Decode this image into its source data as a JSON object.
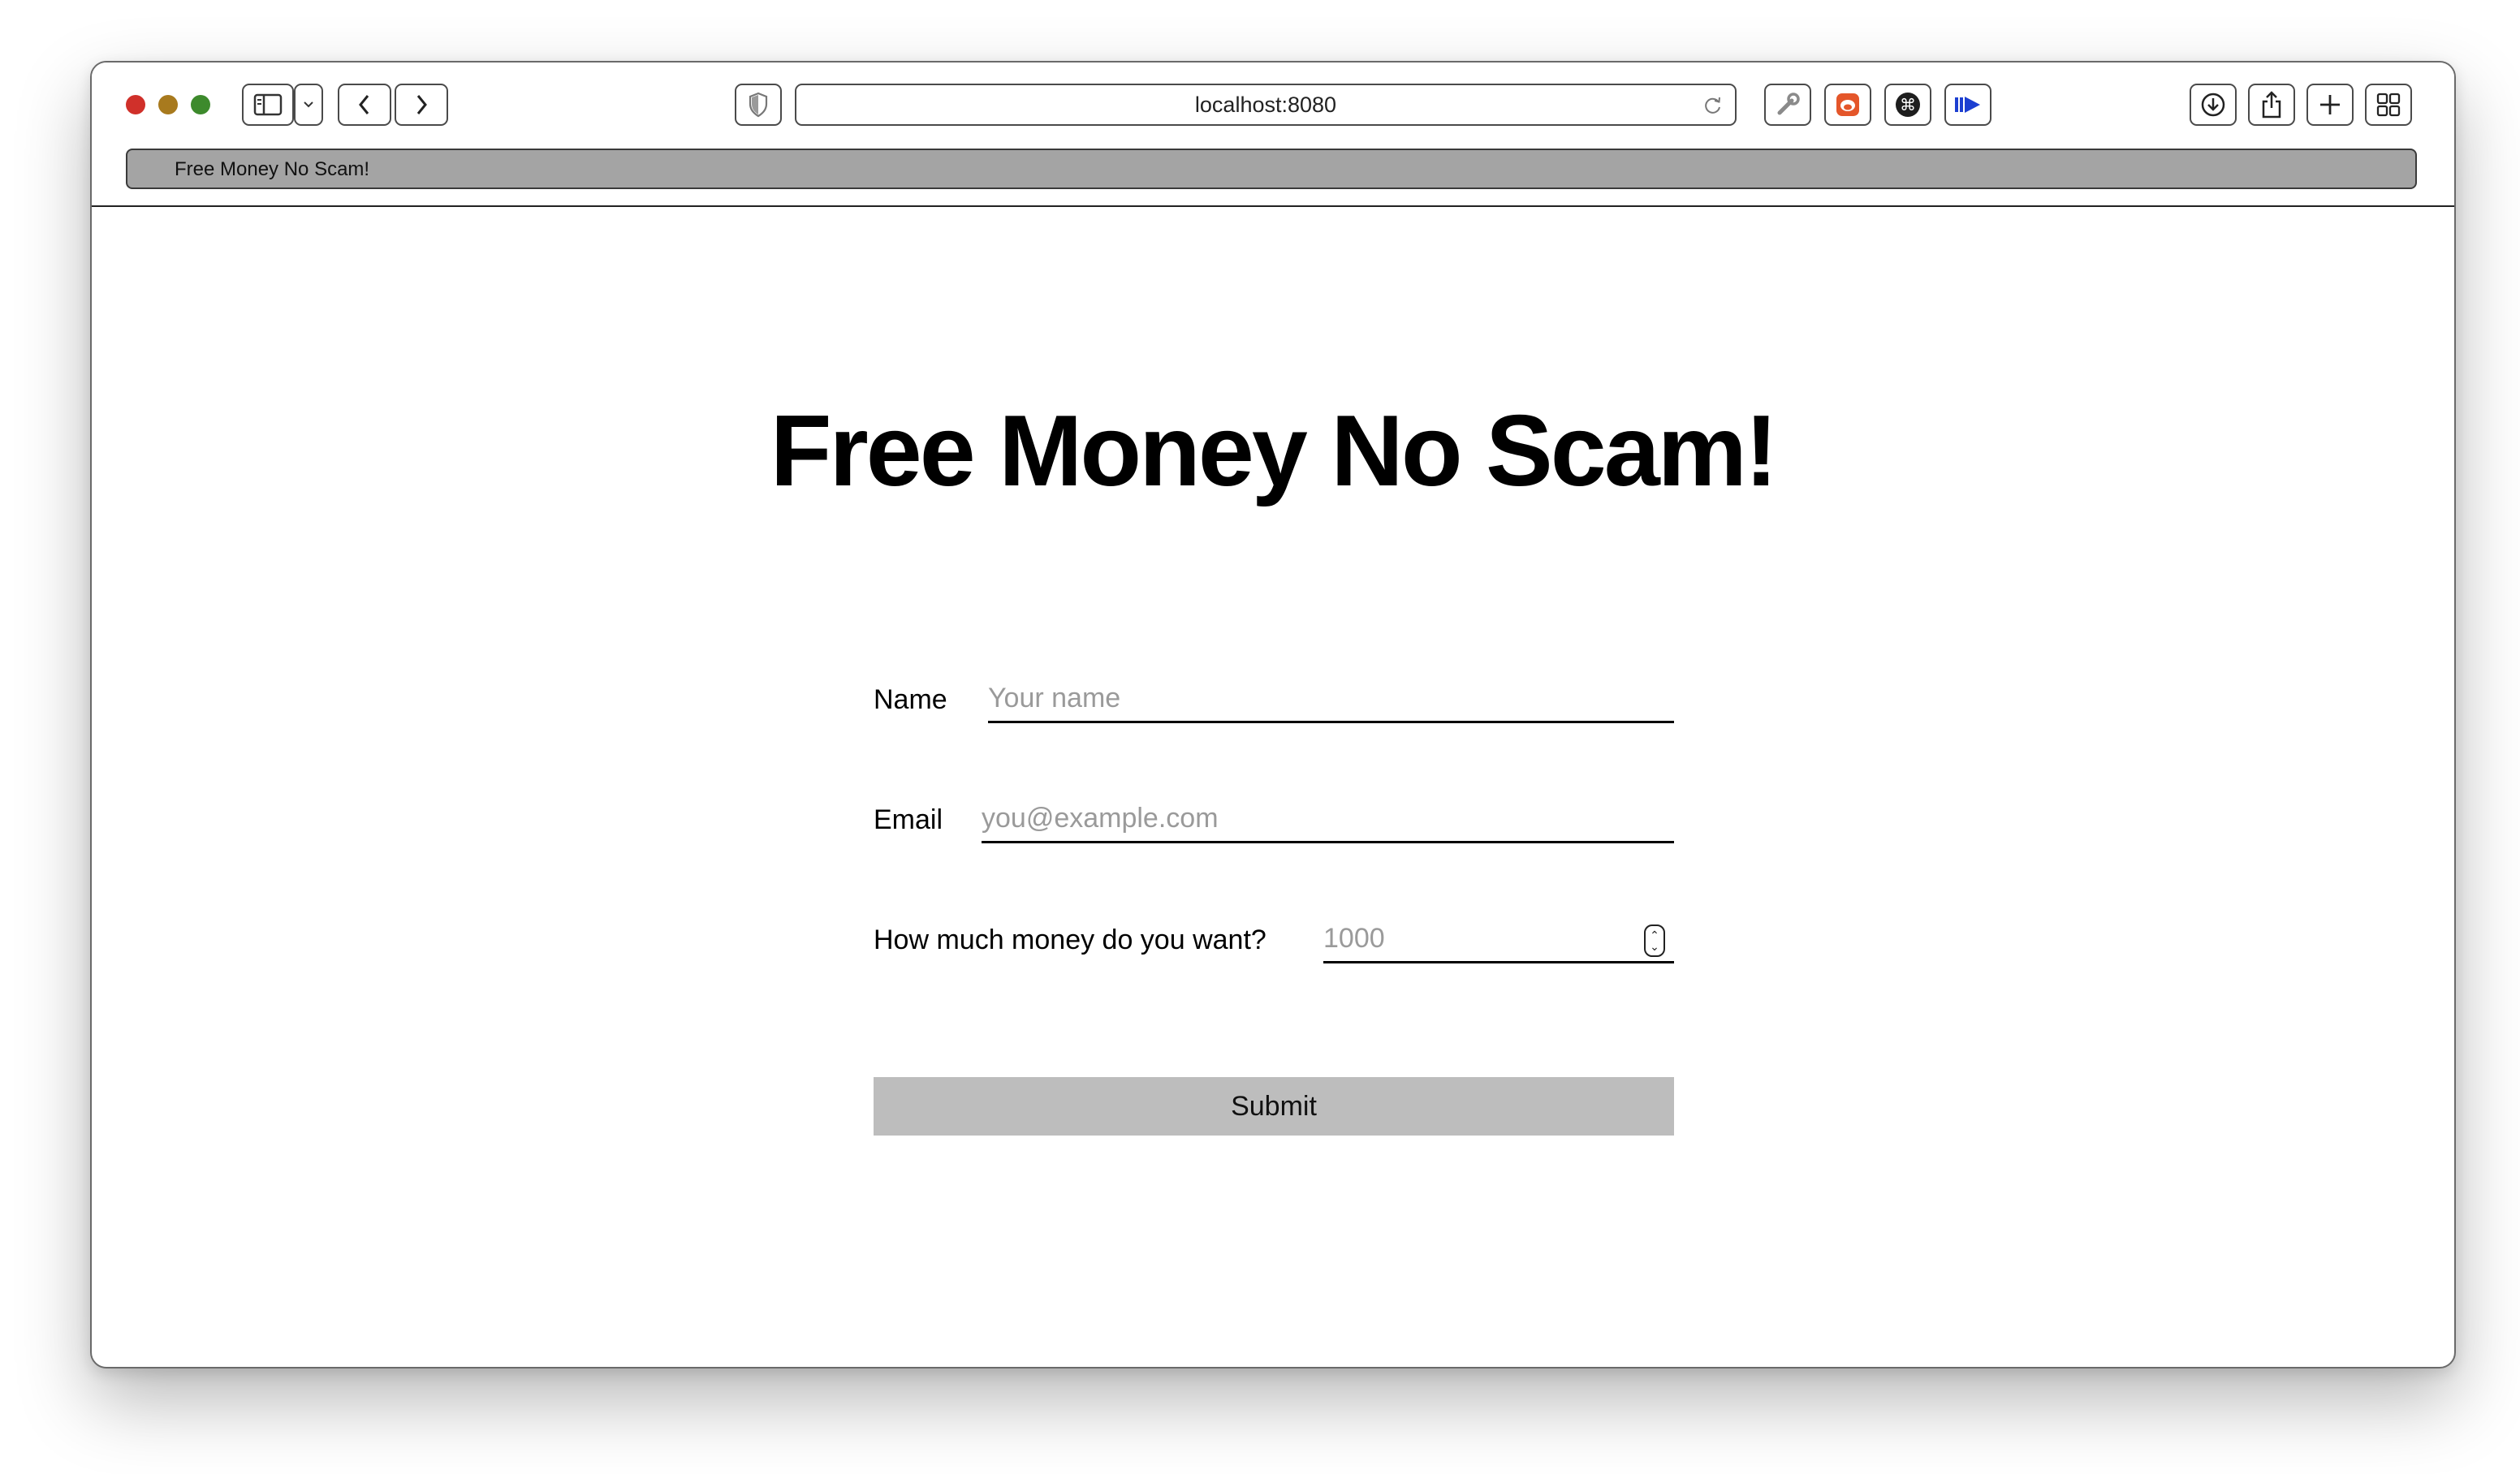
{
  "browser": {
    "url": "localhost:8080",
    "tab_title": "Free Money No Scam!",
    "icons": {
      "sidebar": "sidebar-icon",
      "chevron": "chevron-down-icon",
      "back": "chevron-left-icon",
      "forward": "chevron-right-icon",
      "shield": "shield-icon",
      "reload": "reload-icon",
      "extension_1": "wrench-icon",
      "extension_2": "bear-icon",
      "extension_3": "command-icon",
      "extension_4": "play-icon",
      "downloads": "download-icon",
      "share": "share-icon",
      "new_tab": "plus-icon",
      "tab_overview": "grid-icon"
    },
    "traffic_colors": {
      "close": "#d0302a",
      "minimize": "#a87a1e",
      "maximize": "#3d8a2c"
    }
  },
  "page": {
    "heading": "Free Money No Scam!",
    "form": {
      "name_label": "Name",
      "name_placeholder": "Your name",
      "email_label": "Email",
      "email_placeholder": "you@example.com",
      "money_label": "How much money do you want?",
      "money_placeholder": "1000",
      "submit_label": "Submit"
    },
    "colors": {
      "button_bg": "#bdbdbd",
      "placeholder": "#9a9a9a"
    }
  }
}
